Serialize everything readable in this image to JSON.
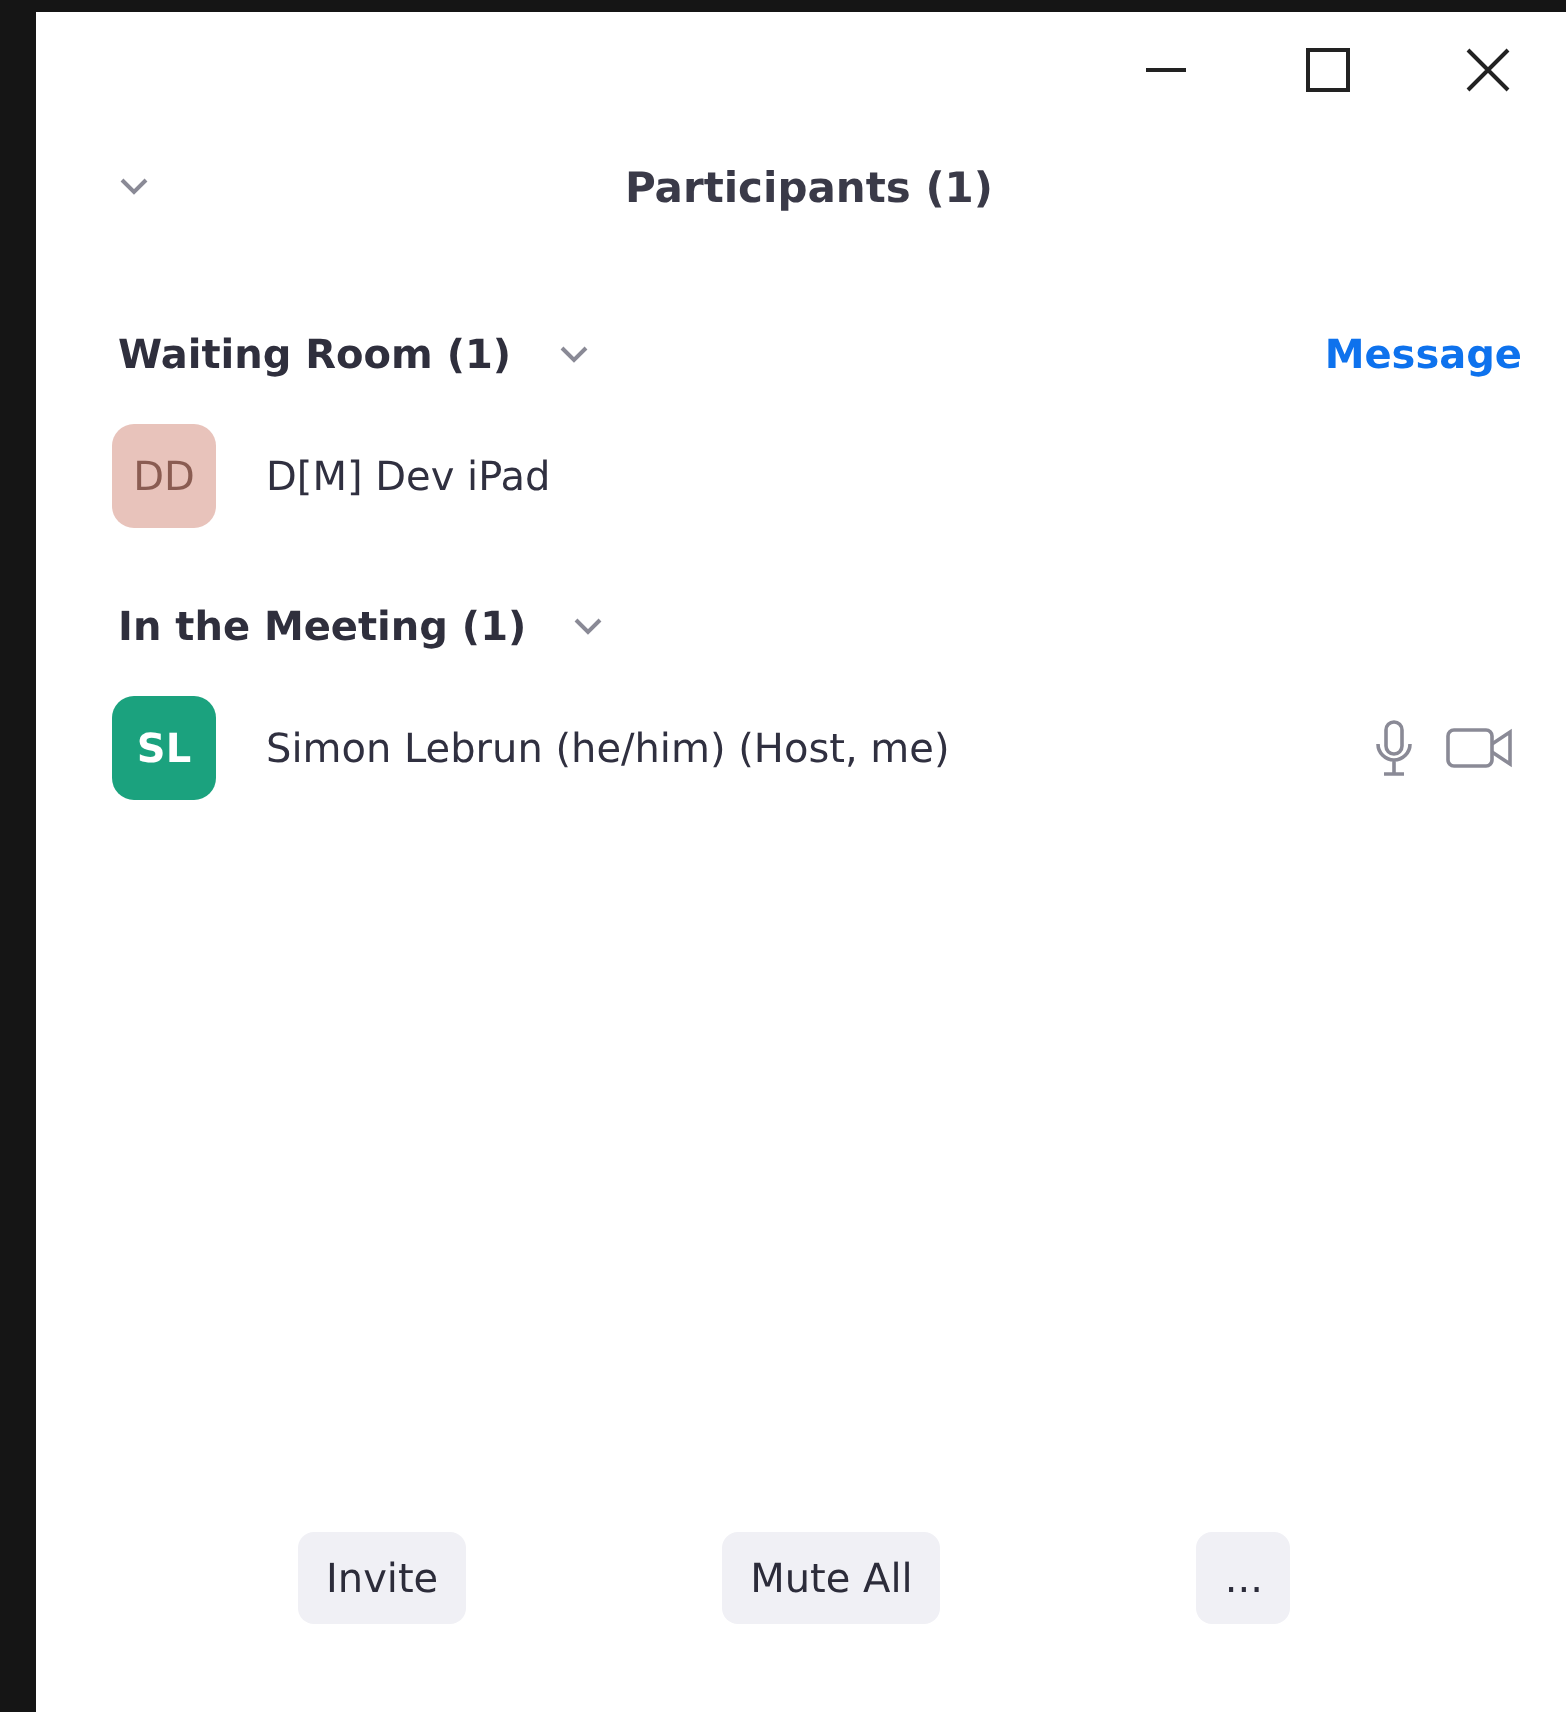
{
  "window": {
    "title": "Participants (1)",
    "collapsed": false
  },
  "sections": [
    {
      "title": "Waiting Room (1)",
      "action": "Message",
      "participants": [
        {
          "initials": "DD",
          "name": "D[M] Dev iPad",
          "color": "#e8c3bb",
          "dimmed": true,
          "media_controls": false
        }
      ]
    },
    {
      "title": "In the Meeting (1)",
      "participants": [
        {
          "initials": "SL",
          "name": "Simon Lebrun (he/him) (Host, me)",
          "color": "#1ba27e",
          "dimmed": false,
          "media_controls": true
        }
      ]
    }
  ],
  "buttons": [
    "Invite",
    "Mute All",
    "..."
  ]
}
